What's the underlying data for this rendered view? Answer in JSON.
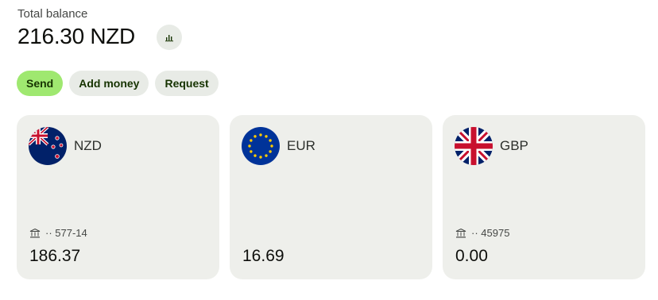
{
  "header": {
    "balance_label": "Total balance",
    "balance_amount": "216.30 NZD",
    "chart_icon": "bar-chart-icon"
  },
  "actions": {
    "send": "Send",
    "add_money": "Add money",
    "request": "Request"
  },
  "colors": {
    "primary_green": "#9fe870",
    "pill_bg": "#e8ebe6",
    "card_bg": "#eeefeb",
    "pill_text": "#163300"
  },
  "balances": [
    {
      "code": "NZD",
      "flag": "new-zealand-flag-icon",
      "account_icon": "bank-icon",
      "account": "·· 577-14",
      "amount": "186.37"
    },
    {
      "code": "EUR",
      "flag": "eu-flag-icon",
      "amount": "16.69"
    },
    {
      "code": "GBP",
      "flag": "uk-flag-icon",
      "account_icon": "bank-icon",
      "account": "·· 45975",
      "amount": "0.00"
    }
  ]
}
